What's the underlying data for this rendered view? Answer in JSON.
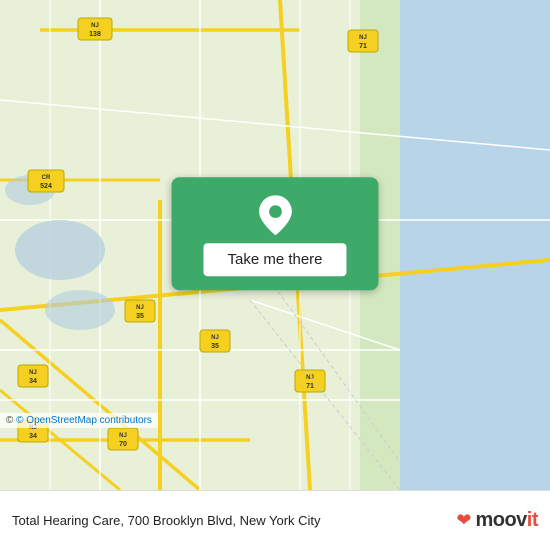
{
  "map": {
    "attribution": "© OpenStreetMap contributors",
    "attribution_link": "https://www.openstreetmap.org/copyright"
  },
  "overlay": {
    "button_label": "Take me there"
  },
  "bottom_bar": {
    "location_text": "Total Hearing Care, 700 Brooklyn Blvd, New York City",
    "brand_name_regular": "moov",
    "brand_name_accent": "it"
  }
}
